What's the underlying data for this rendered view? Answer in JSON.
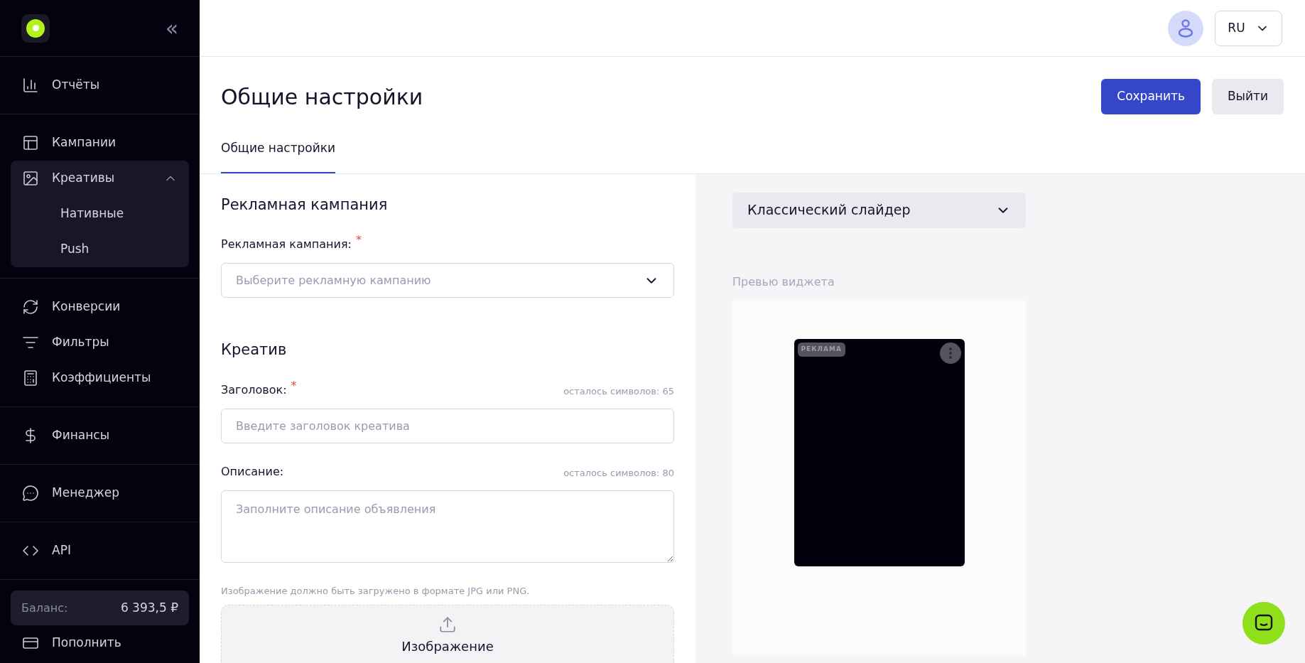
{
  "sidebar": {
    "collapse_icon": "«",
    "sections": [
      [
        {
          "label": "Отчёты"
        }
      ],
      [
        {
          "label": "Кампании"
        },
        {
          "label": "Креативы",
          "expanded": true,
          "children": [
            {
              "label": "Нативные"
            },
            {
              "label": "Push"
            }
          ]
        }
      ],
      [
        {
          "label": "Конверсии"
        },
        {
          "label": "Фильтры"
        },
        {
          "label": "Коэффициенты"
        }
      ],
      [
        {
          "label": "Финансы"
        }
      ],
      [
        {
          "label": "Менеджер"
        }
      ],
      [
        {
          "label": "API"
        }
      ]
    ],
    "balance": {
      "label": "Баланс:",
      "value": "6 393,5 ₽"
    },
    "topup": "Пополнить"
  },
  "header": {
    "language": "RU"
  },
  "page": {
    "title": "Общие настройки",
    "save": "Сохранить",
    "exit": "Выйти",
    "tabs": [
      {
        "label": "Общие настройки",
        "selected": true
      }
    ]
  },
  "form": {
    "sections": [
      {
        "title": "Рекламная кампания",
        "fields": [
          {
            "kind": "select",
            "label": "Рекламная кампания:",
            "required_mark": "*",
            "placeholder": "Выберите рекламную кампанию"
          }
        ]
      },
      {
        "title": "Креатив",
        "fields": [
          {
            "kind": "input",
            "label": "Заголовок:",
            "required_mark": "*",
            "counter": "осталось символов: 65",
            "placeholder": "Введите заголовок креатива"
          },
          {
            "kind": "textarea",
            "label": "Описание:",
            "counter": "осталось символов: 80",
            "placeholder": "Заполните описание объявления"
          }
        ]
      }
    ],
    "image_note": "Изображение должно быть загружено в формате JPG или PNG.",
    "upload_label": "Изображение"
  },
  "preview": {
    "widget_type": "Классический слайдер",
    "label": "Превью виджета",
    "ad_badge": "РЕКЛАМА"
  }
}
